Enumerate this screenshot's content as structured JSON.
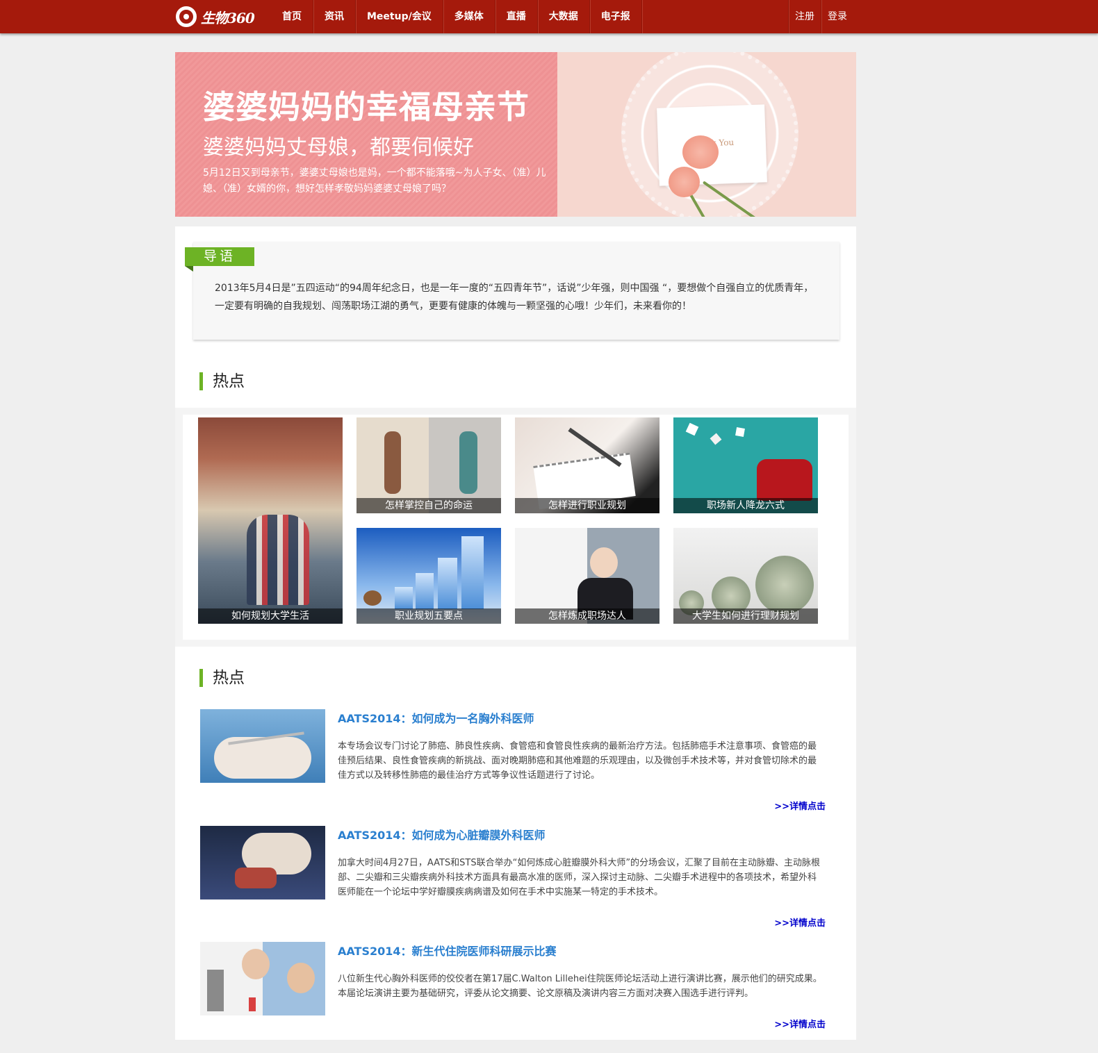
{
  "header": {
    "logo_text": "生物360",
    "nav": [
      "首页",
      "资讯",
      "Meetup/会议",
      "多媒体",
      "直播",
      "大数据",
      "电子报"
    ],
    "register": "注册",
    "login": "登录"
  },
  "banner": {
    "title": "婆婆妈妈的幸福母亲节",
    "subtitle": "婆婆妈妈丈母娘，都要伺候好",
    "desc": "5月12日又到母亲节，婆婆丈母娘也是妈，一个都不能落哦~为人子女、（准）儿媳、（准）女婿的你，想好怎样孝敬妈妈婆婆丈母娘了吗？",
    "card_text": "Thank You"
  },
  "intro": {
    "tag": "导语",
    "text": "2013年5月4日是”五四运动“的94周年纪念日，也是一年一度的“五四青年节”，话说”少年强，则中国强 “，要想做个自强自立的优质青年，一定要有明确的自我规划、闯荡职场江湖的勇气，更要有健康的体魄与一颗坚强的心哦！少年们，未来看你的！"
  },
  "hot": {
    "title": "热点",
    "tiles": [
      {
        "caption": "如何规划大学生活"
      },
      {
        "caption": "怎样掌控自己的命运"
      },
      {
        "caption": "怎样进行职业规划"
      },
      {
        "caption": "职场新人降龙六式"
      },
      {
        "caption": "职业规划五要点"
      },
      {
        "caption": "怎样炼成职场达人"
      },
      {
        "caption": "大学生如何进行理财规划"
      }
    ]
  },
  "hot2": {
    "title": "热点",
    "more_label": ">>详情点击",
    "articles": [
      {
        "title": "AATS2014：如何成为一名胸外科医师",
        "text": "本专场会议专门讨论了肺癌、肺良性疾病、食管癌和食管良性疾病的最新治疗方法。包括肺癌手术注意事项、食管癌的最佳预后结果、良性食管疾病的新挑战、面对晚期肺癌和其他难题的乐观理由，以及微创手术技术等，并对食管切除术的最佳方式以及转移性肺癌的最佳治疗方式等争议性话题进行了讨论。"
      },
      {
        "title": "AATS2014：如何成为心脏瓣膜外科医师",
        "text": "加拿大时间4月27日，AATS和STS联合举办“如何炼成心脏瓣膜外科大师”的分场会议，汇聚了目前在主动脉瓣、主动脉根部、二尖瓣和三尖瓣疾病外科技术方面具有最高水准的医师，深入探讨主动脉、二尖瓣手术进程中的各项技术，希望外科医师能在一个论坛中学好瓣膜疾病病谱及如何在手术中实施某一特定的手术技术。"
      },
      {
        "title": "AATS2014：新生代住院医师科研展示比赛",
        "text": "八位新生代心胸外科医师的佼佼者在第17届C.Walton Lillehei住院医师论坛活动上进行演讲比赛，展示他们的研究成果。本届论坛演讲主要为基础研究，评委从论文摘要、论文原稿及演讲内容三方面对决赛入围选手进行评判。"
      }
    ]
  },
  "colors": {
    "header_bg": "#a51a0c",
    "accent_green": "#6db325",
    "link_blue": "#2a7fcf",
    "banner_pink": "#f1999a"
  }
}
